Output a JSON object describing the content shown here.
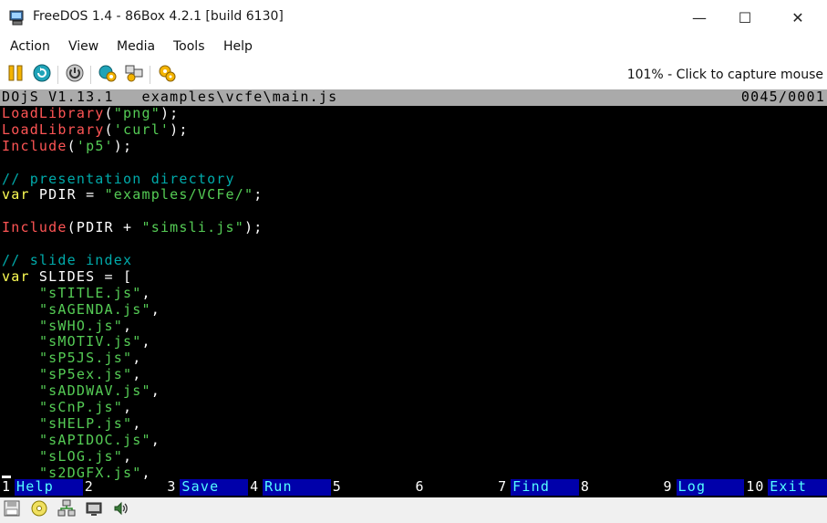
{
  "window": {
    "title": "FreeDOS 1.4 - 86Box 4.2.1 [build 6130]",
    "minimize_glyph": "—",
    "maximize_glyph": "☐",
    "close_glyph": "✕"
  },
  "menu": {
    "items": [
      "Action",
      "View",
      "Media",
      "Tools",
      "Help"
    ]
  },
  "toolbar": {
    "icons": [
      "pause-icon",
      "reset-icon",
      "power-icon",
      "settings-icon",
      "ctrl-alt-del-icon",
      "screenshot-icon"
    ],
    "status": "101% - Click to capture mouse"
  },
  "dos": {
    "header_left": "DOjS V1.13.1   examples\\vcfe\\main.js",
    "header_right": "0045/0001",
    "lines": [
      [
        {
          "t": "LoadLibrary",
          "c": "red"
        },
        {
          "t": "(",
          "c": "white"
        },
        {
          "t": "\"png\"",
          "c": "green"
        },
        {
          "t": ");",
          "c": "white"
        }
      ],
      [
        {
          "t": "LoadLibrary",
          "c": "red"
        },
        {
          "t": "(",
          "c": "white"
        },
        {
          "t": "'curl'",
          "c": "green"
        },
        {
          "t": ");",
          "c": "white"
        }
      ],
      [
        {
          "t": "Include",
          "c": "red"
        },
        {
          "t": "(",
          "c": "white"
        },
        {
          "t": "'p5'",
          "c": "green"
        },
        {
          "t": ");",
          "c": "white"
        }
      ],
      [],
      [
        {
          "t": "// presentation directory",
          "c": "cyan"
        }
      ],
      [
        {
          "t": "var",
          "c": "yellow"
        },
        {
          "t": " PDIR = ",
          "c": "white"
        },
        {
          "t": "\"examples/VCFe/\"",
          "c": "green"
        },
        {
          "t": ";",
          "c": "white"
        }
      ],
      [],
      [
        {
          "t": "Include",
          "c": "red"
        },
        {
          "t": "(PDIR + ",
          "c": "white"
        },
        {
          "t": "\"simsli.js\"",
          "c": "green"
        },
        {
          "t": ");",
          "c": "white"
        }
      ],
      [],
      [
        {
          "t": "// slide index",
          "c": "cyan"
        }
      ],
      [
        {
          "t": "var",
          "c": "yellow"
        },
        {
          "t": " SLIDES = [",
          "c": "white"
        }
      ],
      [
        {
          "t": "    ",
          "c": "white"
        },
        {
          "t": "\"sTITLE.js\"",
          "c": "green"
        },
        {
          "t": ",",
          "c": "white"
        }
      ],
      [
        {
          "t": "    ",
          "c": "white"
        },
        {
          "t": "\"sAGENDA.js\"",
          "c": "green"
        },
        {
          "t": ",",
          "c": "white"
        }
      ],
      [
        {
          "t": "    ",
          "c": "white"
        },
        {
          "t": "\"sWHO.js\"",
          "c": "green"
        },
        {
          "t": ",",
          "c": "white"
        }
      ],
      [
        {
          "t": "    ",
          "c": "white"
        },
        {
          "t": "\"sMOTIV.js\"",
          "c": "green"
        },
        {
          "t": ",",
          "c": "white"
        }
      ],
      [
        {
          "t": "    ",
          "c": "white"
        },
        {
          "t": "\"sP5JS.js\"",
          "c": "green"
        },
        {
          "t": ",",
          "c": "white"
        }
      ],
      [
        {
          "t": "    ",
          "c": "white"
        },
        {
          "t": "\"sP5ex.js\"",
          "c": "green"
        },
        {
          "t": ",",
          "c": "white"
        }
      ],
      [
        {
          "t": "    ",
          "c": "white"
        },
        {
          "t": "\"sADDWAV.js\"",
          "c": "green"
        },
        {
          "t": ",",
          "c": "white"
        }
      ],
      [
        {
          "t": "    ",
          "c": "white"
        },
        {
          "t": "\"sCnP.js\"",
          "c": "green"
        },
        {
          "t": ",",
          "c": "white"
        }
      ],
      [
        {
          "t": "    ",
          "c": "white"
        },
        {
          "t": "\"sHELP.js\"",
          "c": "green"
        },
        {
          "t": ",",
          "c": "white"
        }
      ],
      [
        {
          "t": "    ",
          "c": "white"
        },
        {
          "t": "\"sAPIDOC.js\"",
          "c": "green"
        },
        {
          "t": ",",
          "c": "white"
        }
      ],
      [
        {
          "t": "    ",
          "c": "white"
        },
        {
          "t": "\"sLOG.js\"",
          "c": "green"
        },
        {
          "t": ",",
          "c": "white"
        }
      ],
      [
        {
          "t": "    ",
          "c": "white"
        },
        {
          "t": "\"s2DGFX.js\"",
          "c": "green"
        },
        {
          "t": ",",
          "c": "white"
        }
      ]
    ],
    "fkeys": [
      {
        "num": "1",
        "label": "Help"
      },
      {
        "num": "2",
        "label": ""
      },
      {
        "num": "3",
        "label": "Save"
      },
      {
        "num": "4",
        "label": "Run"
      },
      {
        "num": "5",
        "label": ""
      },
      {
        "num": "6",
        "label": ""
      },
      {
        "num": "7",
        "label": "Find"
      },
      {
        "num": "8",
        "label": ""
      },
      {
        "num": "9",
        "label": "Log"
      },
      {
        "num": "10",
        "label": "Exit"
      }
    ]
  },
  "statusbar": {
    "icons": [
      "floppy-drive-icon",
      "cdrom-drive-icon",
      "network-icon",
      "display-icon",
      "sound-icon"
    ]
  },
  "colors": {
    "red": "#ff5555",
    "yellow": "#ffff55",
    "green": "#55cc55",
    "cyan": "#00aaaa",
    "white": "#ffffff",
    "fkey_bg": "#0000aa",
    "fkey_fg": "#55ffff",
    "header_bg": "#aaaaaa"
  }
}
